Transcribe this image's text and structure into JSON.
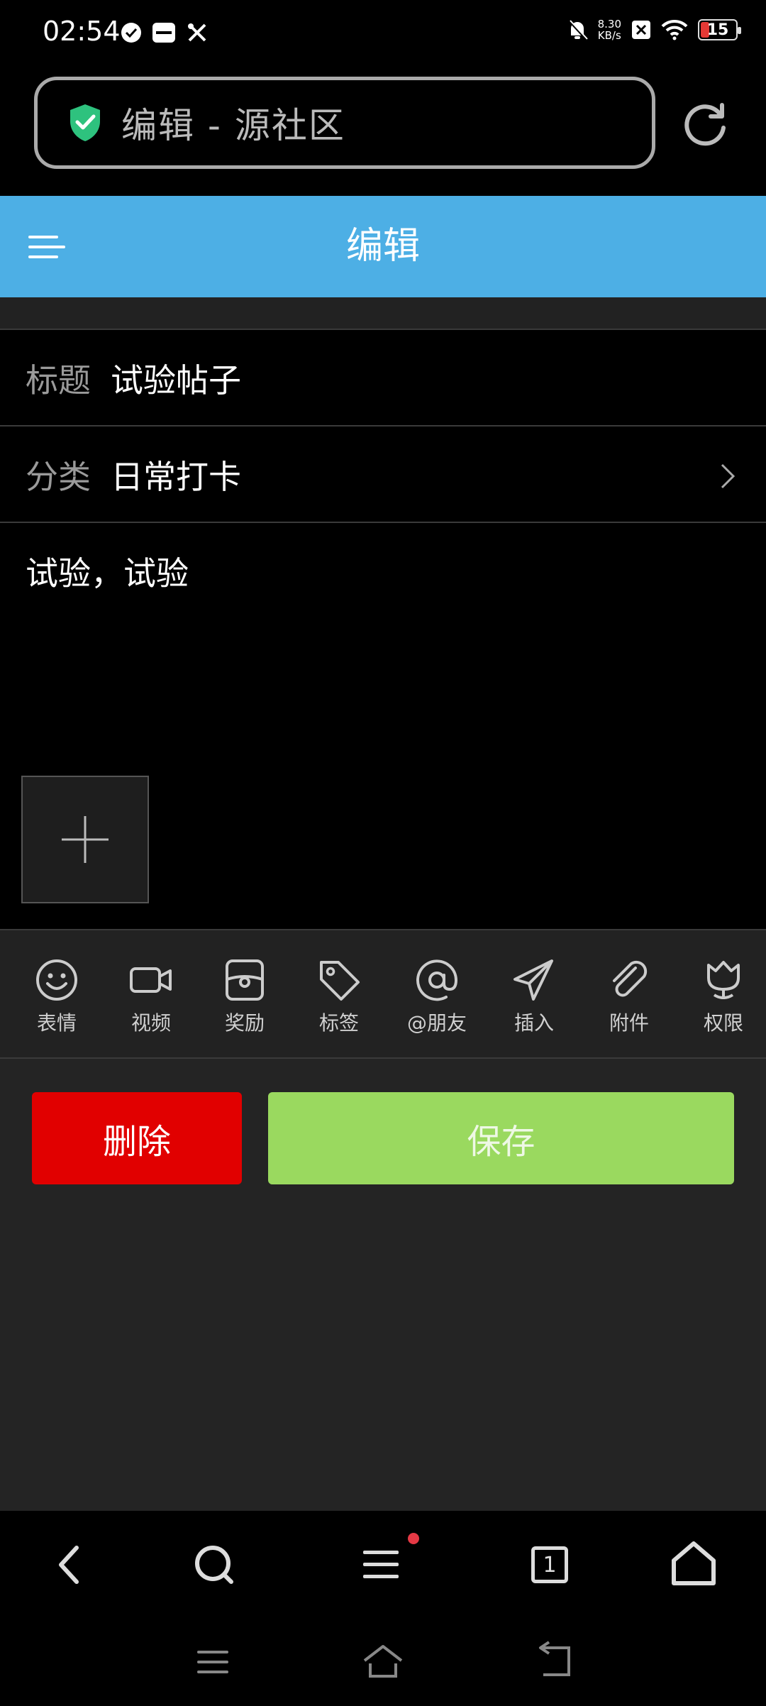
{
  "status_bar": {
    "time": "02:54",
    "net_speed_value": "8.30",
    "net_speed_unit": "KB/s",
    "battery": "15",
    "battery_color": "#e53935"
  },
  "browser": {
    "page_title": "编辑 - 源社区",
    "secure_icon": "shield-check-icon",
    "secure_color": "#2ec27e"
  },
  "header": {
    "title": "编辑",
    "background": "#4dafe5"
  },
  "form": {
    "title_label": "标题",
    "title_value": "试验帖子",
    "category_label": "分类",
    "category_value": "日常打卡",
    "content": "试验，试验"
  },
  "toolbar": {
    "items": [
      {
        "label": "表情",
        "icon": "smiley-icon"
      },
      {
        "label": "视频",
        "icon": "video-camera-icon"
      },
      {
        "label": "奖励",
        "icon": "reward-icon"
      },
      {
        "label": "标签",
        "icon": "tag-icon"
      },
      {
        "label": "@朋友",
        "icon": "at-icon"
      },
      {
        "label": "插入",
        "icon": "paper-plane-icon"
      },
      {
        "label": "附件",
        "icon": "paperclip-icon"
      },
      {
        "label": "权限",
        "icon": "tulip-icon"
      }
    ]
  },
  "actions": {
    "delete_label": "删除",
    "delete_color": "#e10000",
    "save_label": "保存",
    "save_color": "#9ad95f"
  },
  "browser_nav": {
    "tab_count": "1",
    "badge_color": "#e53945"
  }
}
